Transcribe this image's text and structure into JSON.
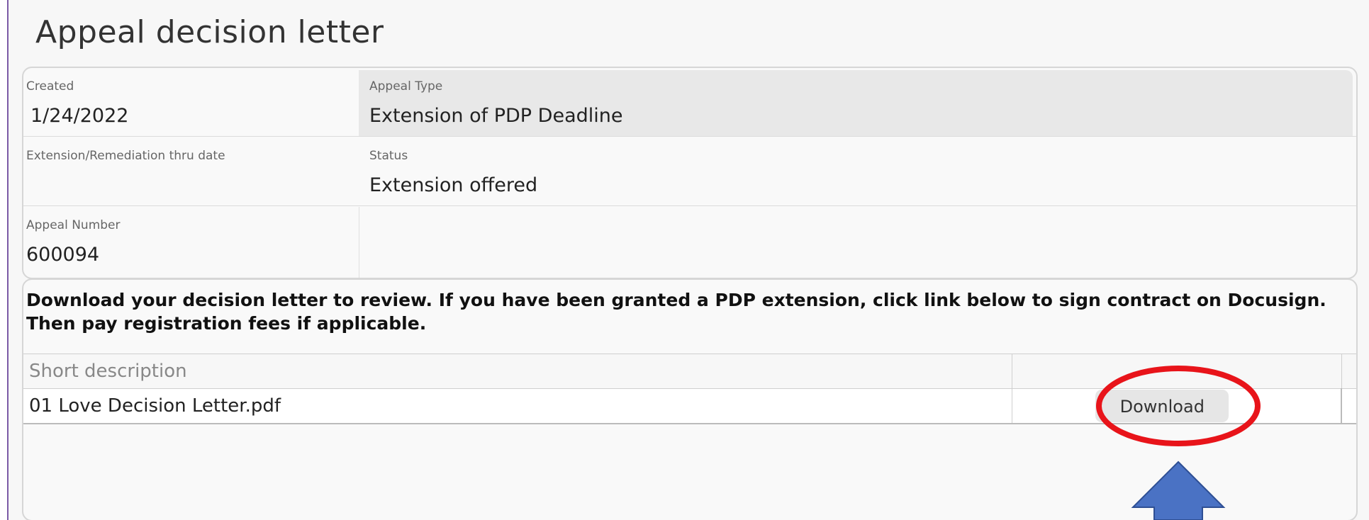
{
  "page": {
    "title": "Appeal decision letter"
  },
  "info": {
    "created": {
      "label": "Created",
      "value": "1/24/2022"
    },
    "appeal_type": {
      "label": "Appeal Type",
      "value": "Extension of PDP Deadline"
    },
    "extension_date": {
      "label": "Extension/Remediation thru date",
      "value": ""
    },
    "status": {
      "label": "Status",
      "value": "Extension offered"
    },
    "appeal_number": {
      "label": "Appeal Number",
      "value": "600094"
    }
  },
  "documents": {
    "instructions": "Download your decision letter to review.  If you have been granted a PDP extension, click link below to sign contract on Docusign.  Then pay registration fees if applicable.",
    "columns": {
      "description": "Short description",
      "action": ""
    },
    "rows": [
      {
        "description": "01 Love Decision Letter.pdf",
        "action_label": "Download"
      }
    ]
  },
  "annotations": {
    "ellipse_color": "#e8141a",
    "arrow_color": "#4a72c4",
    "arrow_outline": "#2e4f94"
  }
}
